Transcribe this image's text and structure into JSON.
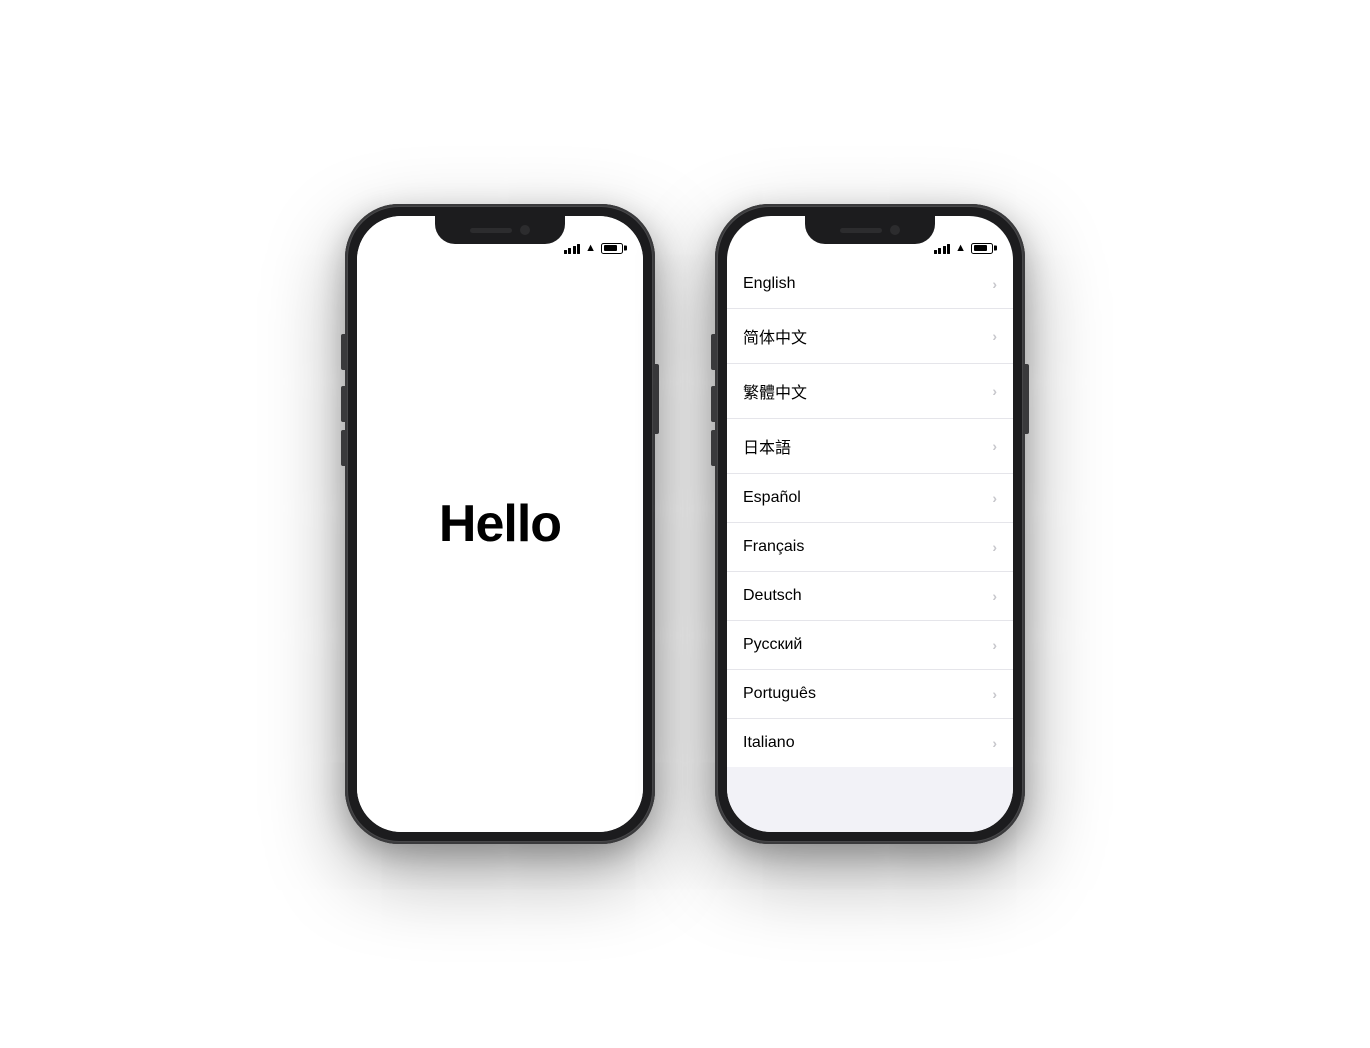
{
  "phone1": {
    "hello_text": "Hello",
    "status": {
      "signal_label": "signal",
      "wifi_label": "wifi",
      "battery_label": "battery"
    }
  },
  "phone2": {
    "status": {
      "signal_label": "signal",
      "wifi_label": "wifi",
      "battery_label": "battery"
    },
    "languages": [
      {
        "id": "english",
        "name": "English"
      },
      {
        "id": "simplified-chinese",
        "name": "简体中文"
      },
      {
        "id": "traditional-chinese",
        "name": "繁體中文"
      },
      {
        "id": "japanese",
        "name": "日本語"
      },
      {
        "id": "spanish",
        "name": "Español"
      },
      {
        "id": "french",
        "name": "Français"
      },
      {
        "id": "german",
        "name": "Deutsch"
      },
      {
        "id": "russian",
        "name": "Русский"
      },
      {
        "id": "portuguese",
        "name": "Português"
      },
      {
        "id": "italian",
        "name": "Italiano"
      }
    ]
  }
}
